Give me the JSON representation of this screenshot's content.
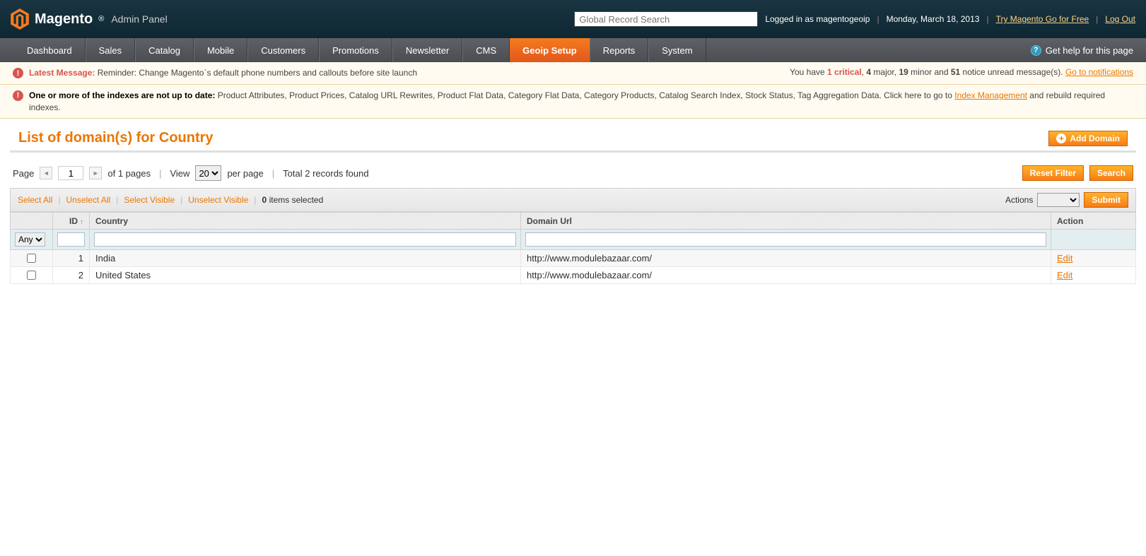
{
  "header": {
    "brand_main": "Magento",
    "brand_sub": "Admin Panel",
    "search_placeholder": "Global Record Search",
    "logged_in_prefix": "Logged in as ",
    "logged_in_user": "magentogeoip",
    "date": "Monday, March 18, 2013",
    "try_link": "Try Magento Go for Free",
    "logout": "Log Out"
  },
  "nav": {
    "items": [
      "Dashboard",
      "Sales",
      "Catalog",
      "Mobile",
      "Customers",
      "Promotions",
      "Newsletter",
      "CMS",
      "Geoip Setup",
      "Reports",
      "System"
    ],
    "active_index": 8,
    "help": "Get help for this page"
  },
  "notice1": {
    "title": "Latest Message:",
    "body": " Reminder: Change Magento`s default phone numbers and callouts before site launch",
    "right_pre": "You have ",
    "critical": "1 critical",
    "major": "4",
    "major_txt": " major, ",
    "minor": "19",
    "minor_txt": " minor and ",
    "notice": "51",
    "notice_txt": " notice unread message(s). ",
    "link": "Go to notifications"
  },
  "notice2": {
    "title": "One or more of the indexes are not up to date:",
    "body": " Product Attributes, Product Prices, Catalog URL Rewrites, Product Flat Data, Category Flat Data, Category Products, Catalog Search Index, Stock Status, Tag Aggregation Data. Click here to go to ",
    "link": "Index Management",
    "body2": " and rebuild required indexes."
  },
  "page": {
    "title": "List of domain(s) for Country",
    "add_button": "Add Domain"
  },
  "pager": {
    "page_label": "Page",
    "page_value": "1",
    "of_pages": "of 1 pages",
    "view_label": "View",
    "per_page_value": "20",
    "per_page_suffix": "per page",
    "total": "Total 2 records found",
    "reset": "Reset Filter",
    "search": "Search"
  },
  "mass": {
    "select_all": "Select All",
    "unselect_all": "Unselect All",
    "select_visible": "Select Visible",
    "unselect_visible": "Unselect Visible",
    "selected_count": "0",
    "selected_suffix": " items selected",
    "actions_label": "Actions",
    "submit": "Submit"
  },
  "grid": {
    "headers": {
      "id": "ID",
      "country": "Country",
      "domain": "Domain Url",
      "action": "Action"
    },
    "filter_any": "Any",
    "rows": [
      {
        "id": "1",
        "country": "India",
        "domain": "http://www.modulebazaar.com/",
        "action": "Edit"
      },
      {
        "id": "2",
        "country": "United States",
        "domain": "http://www.modulebazaar.com/",
        "action": "Edit"
      }
    ]
  }
}
